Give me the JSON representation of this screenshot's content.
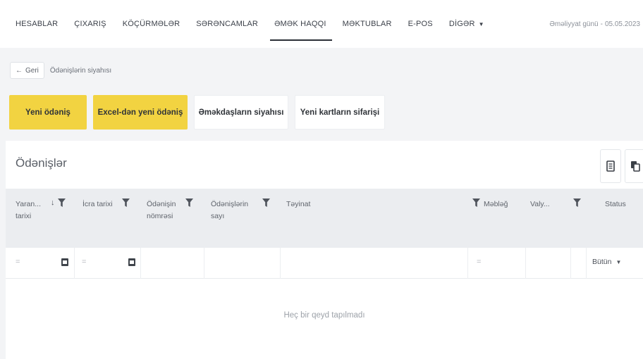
{
  "nav": {
    "items": [
      {
        "label": "HESABLAR"
      },
      {
        "label": "ÇIXARIŞ"
      },
      {
        "label": "KÖÇÜRMƏLƏR"
      },
      {
        "label": "SƏRƏNCAMLAR"
      },
      {
        "label": "ƏMƏK HAQQI",
        "active": true
      },
      {
        "label": "MƏKTUBLAR"
      },
      {
        "label": "E-POS"
      },
      {
        "label": "DİGƏR"
      }
    ],
    "op_day_label": "Əməliyyat günü",
    "op_day_sep": "-",
    "op_day_value": "05.05.2023"
  },
  "breadcrumb": {
    "back_label": "Geri",
    "current": "Ödənişlərin siyahısı"
  },
  "actions": {
    "new_payment": "Yeni ödəniş",
    "excel_payment": "Excel-dən yeni ödəniş",
    "employees": "Əməkdaşların siyahısı",
    "new_cards": "Yeni kartların sifarişi"
  },
  "panel": {
    "title": "Ödənişlər"
  },
  "table": {
    "columns": {
      "created": "Yaran... tarixi",
      "exec_date": "İcra tarixi",
      "pay_number": "Ödənişin nömrəsi",
      "pay_count": "Ödənişlərin sayı",
      "purpose": "Təyinat",
      "amount": "Məbləğ",
      "currency": "Valy...",
      "status": "Status"
    },
    "filters": {
      "eq_sign": "=",
      "status_value": "Bütün"
    },
    "empty_text": "Heç bir qeyd tapılmadı"
  },
  "colors": {
    "accent_yellow": "#f2d341",
    "header_bg": "#ebedf0"
  }
}
